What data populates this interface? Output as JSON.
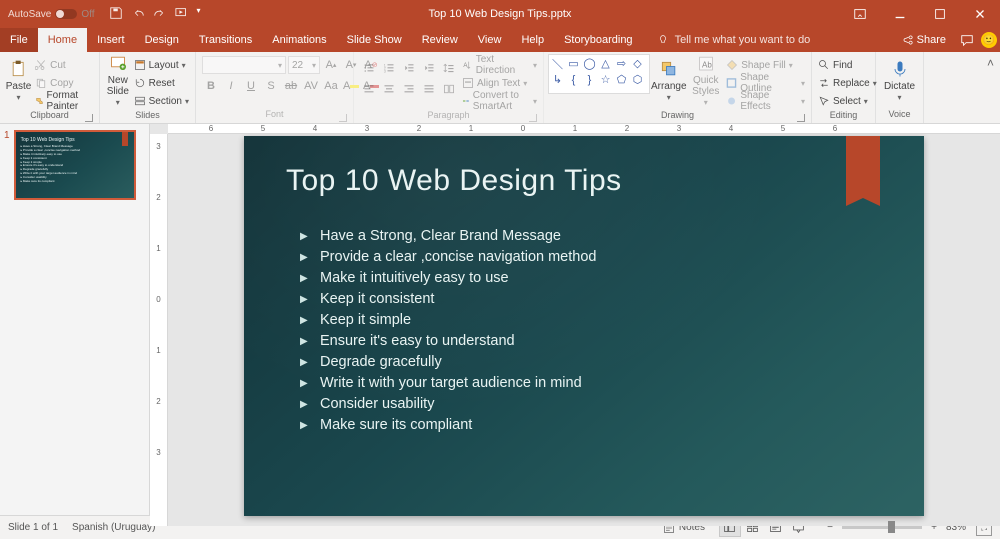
{
  "titlebar": {
    "autosave_label": "AutoSave",
    "autosave_state": "Off",
    "document_title": "Top 10 Web Design Tips.pptx"
  },
  "tabs": {
    "file": "File",
    "home": "Home",
    "insert": "Insert",
    "design": "Design",
    "transitions": "Transitions",
    "animations": "Animations",
    "slideshow": "Slide Show",
    "review": "Review",
    "view": "View",
    "help": "Help",
    "storyboarding": "Storyboarding",
    "tellme": "Tell me what you want to do",
    "share": "Share"
  },
  "ribbon": {
    "clipboard": {
      "label": "Clipboard",
      "paste": "Paste",
      "cut": "Cut",
      "copy": "Copy",
      "format_painter": "Format Painter"
    },
    "slides": {
      "label": "Slides",
      "new_slide": "New\nSlide",
      "layout": "Layout",
      "reset": "Reset",
      "section": "Section"
    },
    "font": {
      "label": "Font",
      "name": "",
      "size": "22"
    },
    "paragraph": {
      "label": "Paragraph",
      "text_direction": "Text Direction",
      "align_text": "Align Text",
      "smartart": "Convert to SmartArt"
    },
    "drawing": {
      "label": "Drawing",
      "arrange": "Arrange",
      "quick_styles": "Quick\nStyles",
      "shape_fill": "Shape Fill",
      "shape_outline": "Shape Outline",
      "shape_effects": "Shape Effects"
    },
    "editing": {
      "label": "Editing",
      "find": "Find",
      "replace": "Replace",
      "select": "Select"
    },
    "voice": {
      "label": "Voice",
      "dictate": "Dictate"
    }
  },
  "ruler": {
    "h": [
      "6",
      "5",
      "4",
      "3",
      "2",
      "1",
      "0",
      "1",
      "2",
      "3",
      "4",
      "5",
      "6"
    ],
    "v": [
      "3",
      "2",
      "1",
      "0",
      "1",
      "2",
      "3"
    ]
  },
  "slide": {
    "title": "Top 10 Web Design Tips",
    "bullets": [
      "Have a Strong, Clear Brand Message",
      "Provide a clear ,concise navigation method",
      "Make it intuitively easy to use",
      "Keep it consistent",
      "Keep it simple",
      "Ensure it's easy to understand",
      "Degrade gracefully",
      "Write it with your target audience in mind",
      "Consider usability",
      "Make sure its compliant"
    ]
  },
  "thumbnail": {
    "number": "1"
  },
  "status": {
    "slide_counter": "Slide 1 of 1",
    "language": "Spanish (Uruguay)",
    "notes": "Notes",
    "zoom": "83%"
  }
}
